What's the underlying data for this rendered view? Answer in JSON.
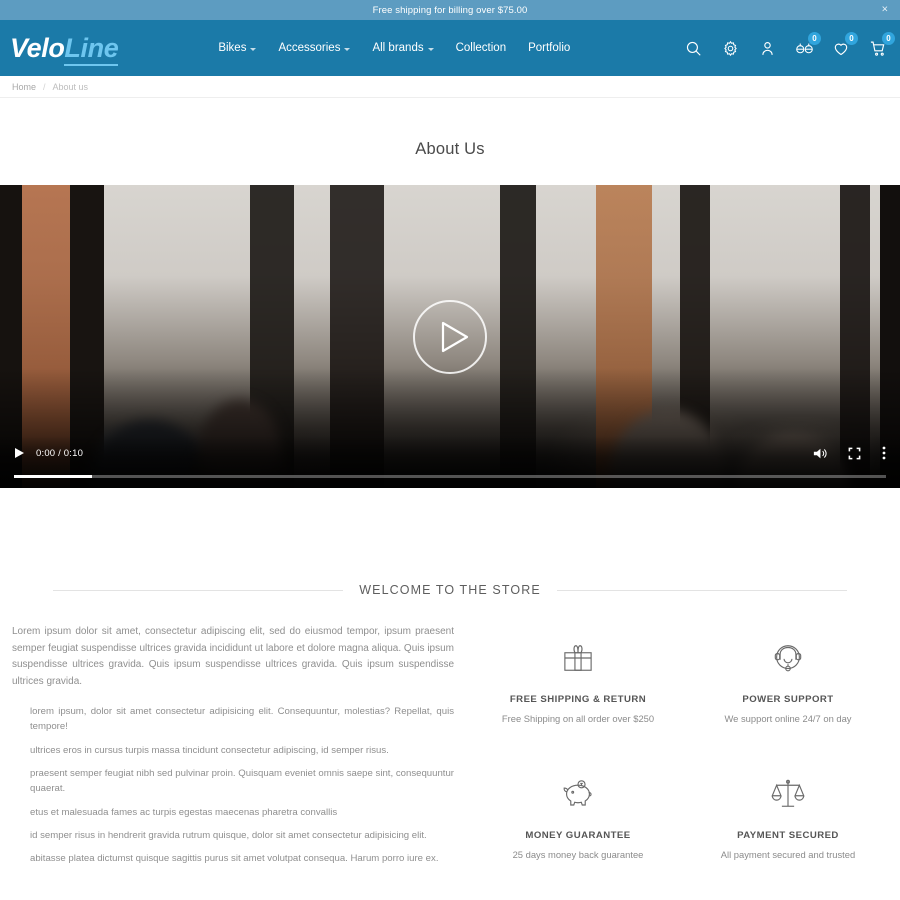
{
  "topbar": {
    "message": "Free shipping for billing over $75.00",
    "close_label": "×"
  },
  "header": {
    "logo_primary": "Velo",
    "logo_accent": "Line",
    "nav": [
      {
        "label": "Bikes",
        "has_dropdown": true
      },
      {
        "label": "Accessories",
        "has_dropdown": true
      },
      {
        "label": "All brands",
        "has_dropdown": true
      },
      {
        "label": "Collection",
        "has_dropdown": false
      },
      {
        "label": "Portfolio",
        "has_dropdown": false
      }
    ],
    "icons": [
      {
        "name": "search-icon",
        "badge": null
      },
      {
        "name": "gear-icon",
        "badge": null
      },
      {
        "name": "user-icon",
        "badge": null
      },
      {
        "name": "compare-icon",
        "badge": "0"
      },
      {
        "name": "wishlist-heart-icon",
        "badge": "0"
      },
      {
        "name": "cart-icon",
        "badge": "0"
      }
    ],
    "colors": {
      "topbar_bg": "#5d9cc1",
      "header_bg": "#1b7aa8",
      "accent": "#6ec6ef",
      "badge_bg": "#31a5dd"
    }
  },
  "breadcrumb": {
    "home": "Home",
    "separator": "/",
    "current": "About us"
  },
  "page": {
    "title": "About Us"
  },
  "video": {
    "current_time": "0:00",
    "duration": "0:10",
    "time_display": "0:00 / 0:10",
    "play_label": "Play",
    "mute_label": "Mute",
    "fullscreen_label": "Full screen",
    "menu_label": "More options"
  },
  "welcome": {
    "section_title": "WELCOME TO THE STORE",
    "lead": "Lorem ipsum dolor sit amet, consectetur adipiscing elit, sed do eiusmod tempor, ipsum praesent semper feugiat suspendisse ultrices gravida incididunt ut labore et dolore magna aliqua. Quis ipsum suspendisse ultrices gravida. Quis ipsum suspendisse ultrices gravida. Quis ipsum suspendisse ultrices gravida.",
    "bullets": [
      "lorem ipsum, dolor sit amet consectetur adipisicing elit. Consequuntur, molestias? Repellat, quis tempore!",
      "ultrices eros in cursus turpis massa tincidunt consectetur adipiscing, id semper risus.",
      "praesent semper feugiat nibh sed pulvinar proin. Quisquam eveniet omnis saepe sint, consequuntur quaerat.",
      "etus et malesuada fames ac turpis egestas maecenas pharetra convallis",
      "id semper risus in hendrerit gravida rutrum quisque, dolor sit amet consectetur adipisicing elit.",
      "abitasse platea dictumst quisque sagittis purus sit amet volutpat consequa. Harum porro iure ex."
    ]
  },
  "features": [
    {
      "icon": "gift-box-icon",
      "title": "FREE SHIPPING & RETURN",
      "desc": "Free Shipping on all order over $250"
    },
    {
      "icon": "headset-support-icon",
      "title": "POWER SUPPORT",
      "desc": "We support online 24/7 on day"
    },
    {
      "icon": "piggy-bank-icon",
      "title": "MONEY GUARANTEE",
      "desc": "25 days money back guarantee"
    },
    {
      "icon": "balance-scale-icon",
      "title": "PAYMENT SECURED",
      "desc": "All payment secured and trusted"
    }
  ]
}
